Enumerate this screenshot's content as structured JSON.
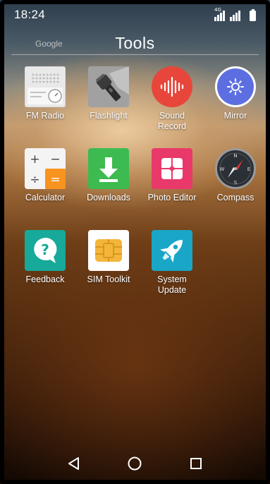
{
  "status_bar": {
    "time": "18:24",
    "network": "4G"
  },
  "folder": {
    "search_label": "Google",
    "title": "Tools"
  },
  "apps": [
    {
      "label": "FM Radio",
      "icon": "fm-radio-icon"
    },
    {
      "label": "Flashlight",
      "icon": "flashlight-icon"
    },
    {
      "label": "Sound\nRecord",
      "icon": "sound-record-icon"
    },
    {
      "label": "Mirror",
      "icon": "mirror-icon"
    },
    {
      "label": "Calculator",
      "icon": "calculator-icon"
    },
    {
      "label": "Downloads",
      "icon": "downloads-icon"
    },
    {
      "label": "Photo Editor",
      "icon": "photo-editor-icon"
    },
    {
      "label": "Compass",
      "icon": "compass-icon"
    },
    {
      "label": "Feedback",
      "icon": "feedback-icon"
    },
    {
      "label": "SIM Toolkit",
      "icon": "sim-toolkit-icon"
    },
    {
      "label": "System\nUpdate",
      "icon": "system-update-icon"
    }
  ],
  "calculator_glyphs": {
    "plus": "+",
    "minus": "−",
    "divide": "÷",
    "equals": "="
  },
  "compass_letters": {
    "n": "N",
    "e": "E",
    "s": "S",
    "w": "W"
  },
  "feedback_glyph": "?",
  "nav": {
    "back": "back-icon",
    "home": "home-icon",
    "recents": "recents-icon"
  },
  "colors": {
    "sound_record": "#e8463b",
    "mirror": "#5d6fe0",
    "calculator_accent": "#f7931e",
    "downloads": "#3dbb50",
    "photo_editor": "#e8396a",
    "feedback": "#17a99a",
    "sim_gold": "#f3b53a",
    "system_update": "#1aa6c7"
  }
}
